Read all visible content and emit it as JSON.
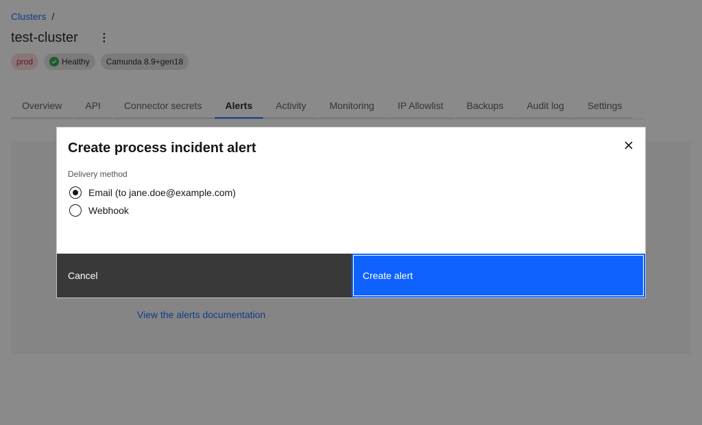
{
  "breadcrumb": {
    "clusters_label": "Clusters",
    "separator": "/"
  },
  "page": {
    "title": "test-cluster",
    "kebab_glyph": "⋮"
  },
  "tags": {
    "env": "prod",
    "health": "Healthy",
    "version": "Camunda 8.9+gen18"
  },
  "tabs": [
    {
      "label": "Overview",
      "active": false
    },
    {
      "label": "API",
      "active": false
    },
    {
      "label": "Connector secrets",
      "active": false
    },
    {
      "label": "Alerts",
      "active": true
    },
    {
      "label": "Activity",
      "active": false
    },
    {
      "label": "Monitoring",
      "active": false
    },
    {
      "label": "IP Allowlist",
      "active": false
    },
    {
      "label": "Backups",
      "active": false
    },
    {
      "label": "Audit log",
      "active": false
    },
    {
      "label": "Settings",
      "active": false
    }
  ],
  "content": {
    "docs_link": "View the alerts documentation"
  },
  "modal": {
    "title": "Create process incident alert",
    "delivery_label": "Delivery method",
    "options": [
      {
        "label": "Email (to jane.doe@example.com)",
        "selected": true
      },
      {
        "label": "Webhook",
        "selected": false
      }
    ],
    "cancel_label": "Cancel",
    "create_label": "Create alert"
  },
  "colors": {
    "primary": "#0f62fe",
    "secondary_button": "#393939",
    "healthy": "#24a148",
    "prod_tag_bg": "#ffd7d9"
  },
  "icons": {
    "close": "close-icon",
    "check": "checkmark-filled-icon",
    "menu": "overflow-menu-vertical-icon"
  }
}
